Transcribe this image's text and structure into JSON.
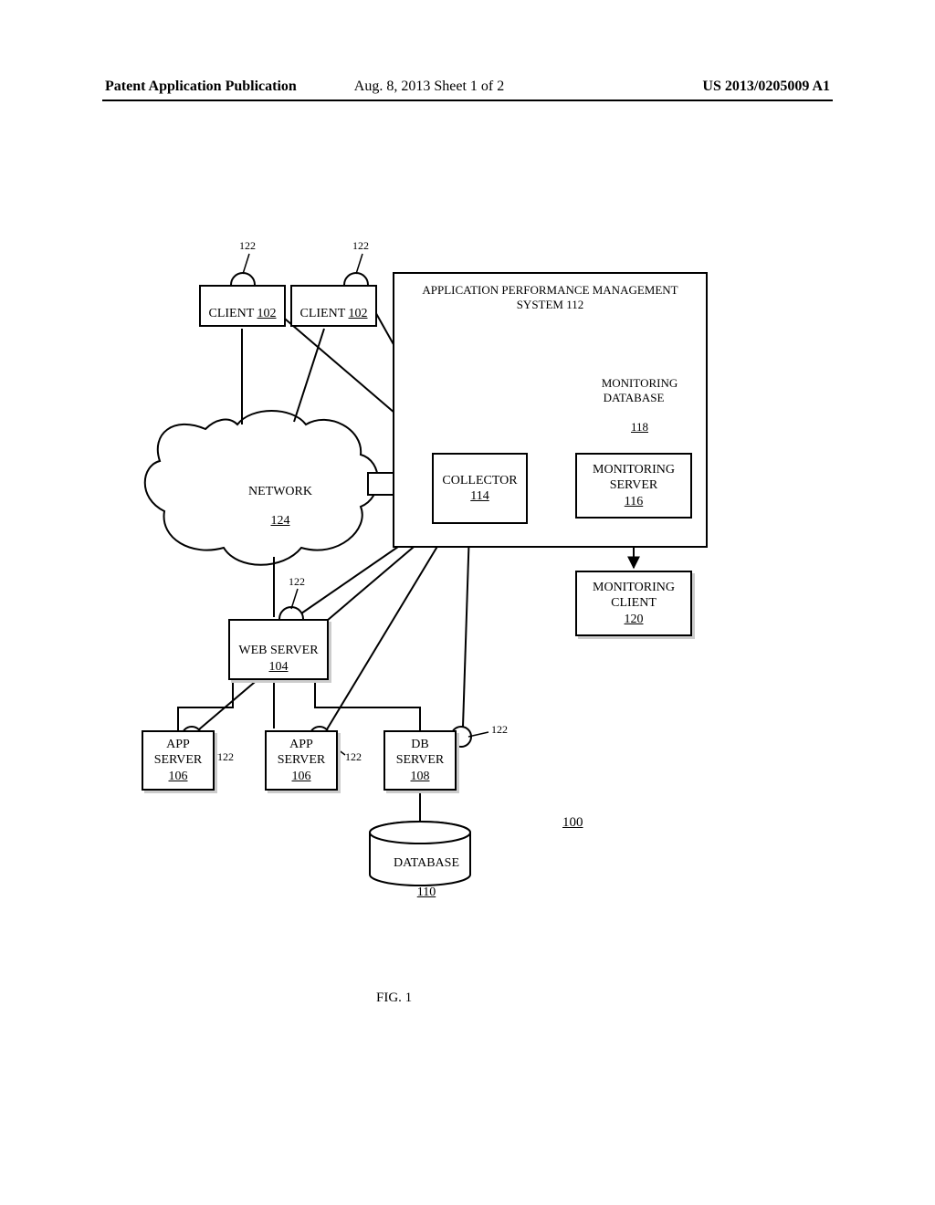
{
  "header": {
    "left": "Patent Application Publication",
    "center": "Aug. 8, 2013   Sheet 1 of 2",
    "right": "US 2013/0205009 A1"
  },
  "figure_label": "FIG. 1",
  "system_number": "100",
  "ref": {
    "r122": "122",
    "r124": "124"
  },
  "boxes": {
    "client1": {
      "name": "CLIENT",
      "num": "102"
    },
    "client2": {
      "name": "CLIENT",
      "num": "102"
    },
    "network": {
      "name": "NETWORK",
      "num": "124"
    },
    "webserver": {
      "name": "WEB SERVER",
      "num": "104"
    },
    "appserver1": {
      "name": "APP\nSERVER",
      "num": "106"
    },
    "appserver2": {
      "name": "APP\nSERVER",
      "num": "106"
    },
    "dbserver": {
      "name": "DB\nSERVER",
      "num": "108"
    },
    "database": {
      "name": "DATABASE",
      "num": "110"
    },
    "apm": {
      "name": "APPLICATION PERFORMANCE MANAGEMENT\nSYSTEM",
      "num": "112"
    },
    "collector": {
      "name": "COLLECTOR",
      "num": "114"
    },
    "monserver": {
      "name": "MONITORING\nSERVER",
      "num": "116"
    },
    "mondb": {
      "name": "MONITORING\nDATABASE",
      "num": "118"
    },
    "monclient": {
      "name": "MONITORING\nCLIENT",
      "num": "120"
    }
  }
}
